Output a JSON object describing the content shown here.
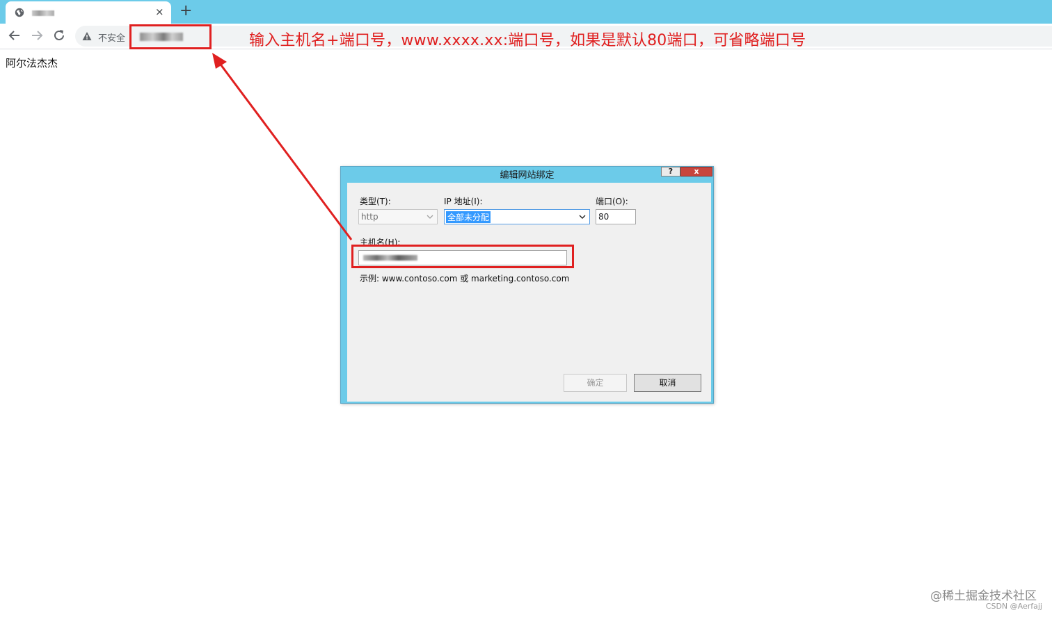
{
  "browser": {
    "tab_close": "×",
    "new_tab": "+",
    "security_label": "不安全"
  },
  "page": {
    "body_text": "阿尔法杰杰"
  },
  "annotation": {
    "text": "输入主机名+端口号，www.xxxx.xx:端口号，如果是默认80端口，可省略端口号",
    "color": "#e02020"
  },
  "dialog": {
    "title": "编辑网站绑定",
    "help_btn": "?",
    "close_btn": "x",
    "type_label": "类型(T):",
    "type_value": "http",
    "ip_label": "IP 地址(I):",
    "ip_value": "全部未分配",
    "port_label": "端口(O):",
    "port_value": "80",
    "host_label": "主机名(H):",
    "example_text": "示例: www.contoso.com 或 marketing.contoso.com",
    "ok_label": "确定",
    "cancel_label": "取消"
  },
  "watermark": {
    "main": "@稀土掘金技术社区",
    "sub": "CSDN @Aerfajj"
  },
  "colors": {
    "tabbar": "#6ccbe9",
    "annotation_red": "#e02020",
    "selection_blue": "#3399ff"
  }
}
